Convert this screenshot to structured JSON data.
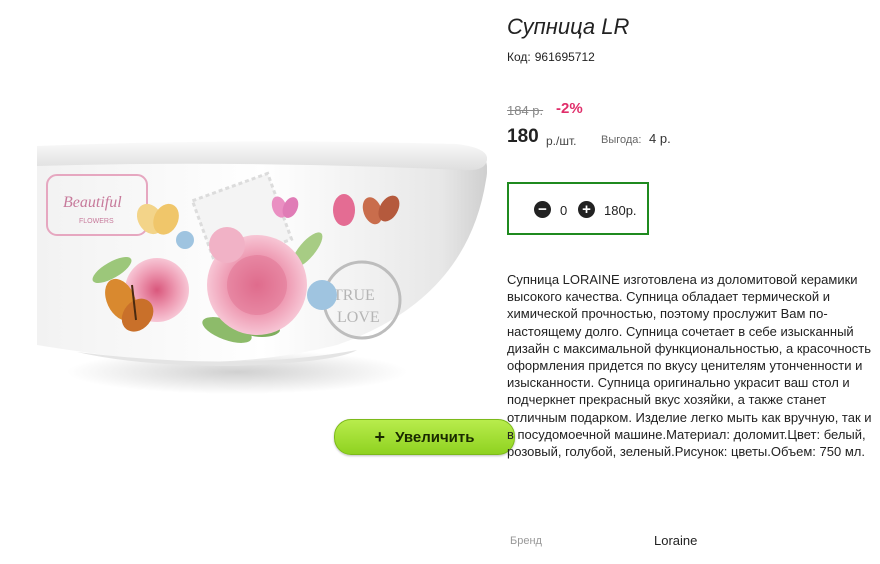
{
  "product": {
    "title": "Супница LR",
    "code_label": "Код:",
    "code_value": "961695712",
    "old_price": "184 р.",
    "discount": "-2%",
    "price": "180",
    "price_unit": "р./шт.",
    "savings_label": "Выгода:",
    "savings_value": "4 р.",
    "description": "Супница LORAINE изготовлена из доломитовой керамики высокого качества. Супница обладает термической и химической прочностью, поэтому прослужит Вам по-настоящему долго. Супница сочетает в себе изысканный дизайн с максимальной функциональностью, а красочность оформления придется по вкусу ценителям утонченности и изысканности. Супница оригинально украсит ваш стол и подчеркнет прекрасный вкус хозяйки, а также станет отличным подарком. Изделие легко мыть как вручную, так и в посудомоечной машине.Материал: доломит.Цвет: белый, розовый, голубой, зеленый.Рисунок: цветы.Объем: 750 мл.",
    "brand_label": "Бренд",
    "brand_value": "Loraine"
  },
  "quantity": {
    "minus_icon": "minus-circle-icon",
    "plus_icon": "plus-circle-icon",
    "value": "0",
    "total": "180р."
  },
  "image": {
    "zoom_plus": "+",
    "zoom_label": "Увеличить",
    "decor_text_1": "Beautiful",
    "decor_text_2": "FLOWERS",
    "decor_text_3": "TRUE",
    "decor_text_4": "LOVE"
  },
  "colors": {
    "discount": "#e02e6a",
    "qty_border": "#1f8a1f",
    "zoom_button": "#a6e03a"
  }
}
